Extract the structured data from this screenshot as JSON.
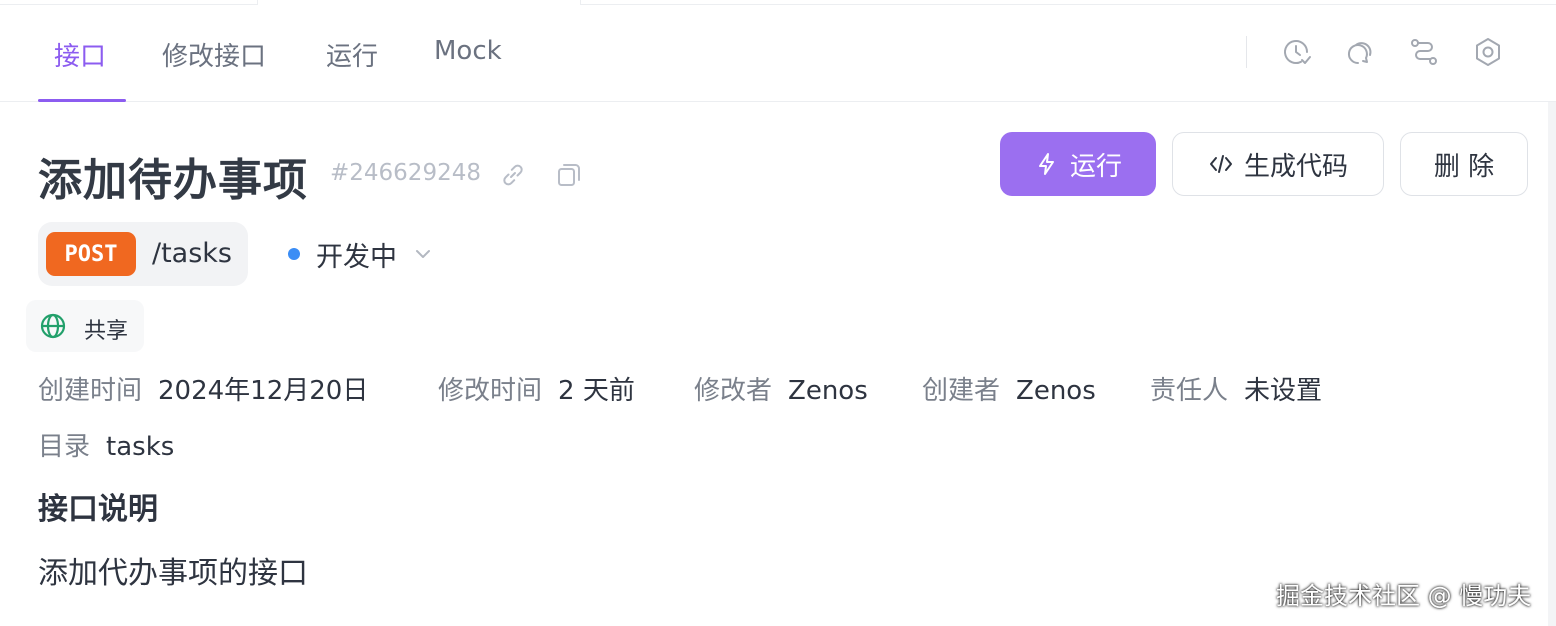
{
  "tabs": {
    "interface": "接口",
    "edit_interface": "修改接口",
    "run": "运行",
    "mock": "Mock"
  },
  "toolbar_icons": [
    "history-icon",
    "comment-icon",
    "flow-icon",
    "settings-icon"
  ],
  "api": {
    "title": "添加待办事项",
    "id": "#246629248",
    "method": "POST",
    "path": "/tasks",
    "status": "开发中",
    "share": "共享"
  },
  "actions": {
    "run_label": "运行",
    "generate_code_label": "生成代码",
    "delete_label": "删 除"
  },
  "meta": {
    "created_time_label": "创建时间",
    "created_time": "2024年12月20日",
    "modified_time_label": "修改时间",
    "modified_time": "2 天前",
    "modifier_label": "修改者",
    "modifier": "Zenos",
    "creator_label": "创建者",
    "creator": "Zenos",
    "owner_label": "责任人",
    "owner": "未设置",
    "directory_label": "目录",
    "directory": "tasks"
  },
  "description": {
    "heading": "接口说明",
    "text": "添加代办事项的接口"
  },
  "watermark": "掘金技术社区 @ 慢功夫",
  "colors": {
    "accent": "#8c5cf0",
    "run_button": "#9b6ff0",
    "post_badge": "#f06820",
    "status_dot": "#3b8df5",
    "share_icon": "#22a06b"
  }
}
